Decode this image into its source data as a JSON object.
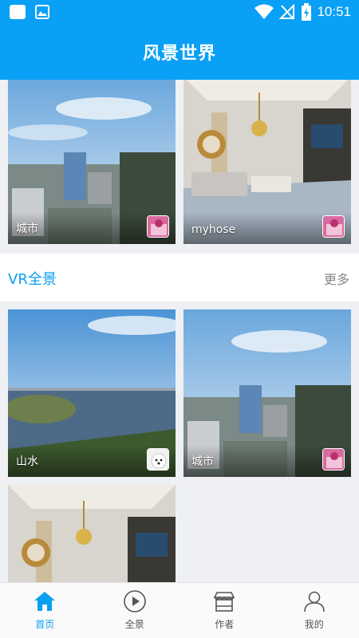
{
  "status_bar": {
    "time": "10:51"
  },
  "app": {
    "title": "风景世界"
  },
  "top_cards": [
    {
      "label": "城市"
    },
    {
      "label": "myhose"
    }
  ],
  "section": {
    "title": "VR全景",
    "more": "更多"
  },
  "vr_cards": [
    {
      "label": "山水"
    },
    {
      "label": "城市"
    },
    {
      "label": ""
    }
  ],
  "tabs": [
    {
      "label": "首页",
      "icon": "home-icon",
      "active": true
    },
    {
      "label": "全景",
      "icon": "play-circle-icon",
      "active": false
    },
    {
      "label": "作者",
      "icon": "shop-icon",
      "active": false
    },
    {
      "label": "我的",
      "icon": "person-icon",
      "active": false
    }
  ],
  "colors": {
    "primary": "#0aa0f5",
    "accent_text": "#0a9ff0",
    "background": "#eef0f4"
  }
}
